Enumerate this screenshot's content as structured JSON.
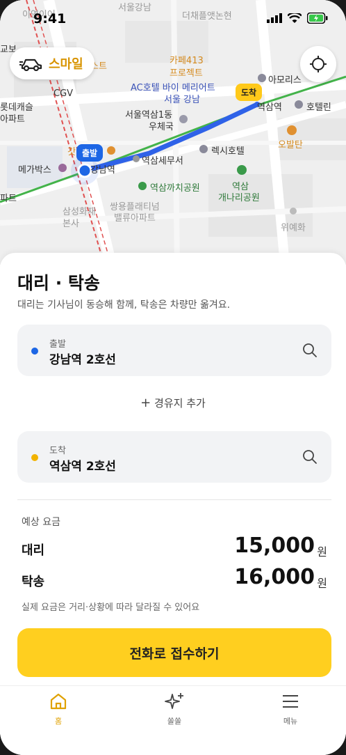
{
  "status_bar": {
    "time": "9:41"
  },
  "brand": {
    "name": "스마일",
    "icon": "car-icon"
  },
  "map": {
    "start_badge": "출발",
    "end_badge": "도착",
    "labels": {
      "l1": "이연이어",
      "l2": "서울강남",
      "l3": "더채플앳논현",
      "l4": "교보",
      "l5": "CGV",
      "l6": "롯데캐슬",
      "l7": "아파트",
      "l8": "카페413",
      "l9": "프로젝트",
      "l10": "AC호텔 바이 메리어트",
      "l11": "서울 강남",
      "l12": "아모리스",
      "l13": "역삼역",
      "l14": "호텔린",
      "l15": "서울역삼1동",
      "l16": "우체국",
      "l17": "오발탄",
      "l18": "렉시호텔",
      "l19": "메가박스",
      "l20": "강남역",
      "l21": "역삼세무서",
      "l22": "역삼까치공원",
      "l23": "역삼",
      "l24": "개나리공원",
      "l25": "삼성화재",
      "l26": "본사",
      "l27": "쌍용플래티넘",
      "l28": "밸류아파트",
      "l29": "위예화",
      "l30": "파트",
      "l31": "갓",
      "l32": "스트"
    }
  },
  "sheet": {
    "title": "대리 · 탁송",
    "subtitle": "대리는 기사님이 동승해 함께, 탁송은 차량만 옮겨요.",
    "origin": {
      "label": "출발",
      "value": "강남역 2호선",
      "color": "#1d66e5"
    },
    "waypoint": "경유지 추가",
    "destination": {
      "label": "도착",
      "value": "역삼역 2호선",
      "color": "#f2b300"
    },
    "fare_label": "예상 요금",
    "fares": [
      {
        "name": "대리",
        "amount": "15,000",
        "unit": "원"
      },
      {
        "name": "탁송",
        "amount": "16,000",
        "unit": "원"
      }
    ],
    "note": "실제 요금은 거리·상황에 따라 달라질 수 있어요",
    "cta": "전화로 접수하기"
  },
  "tabs": [
    {
      "label": "홈",
      "icon": "home-icon",
      "active": true
    },
    {
      "label": "쏠쏠",
      "icon": "sparkle-icon",
      "active": false
    },
    {
      "label": "메뉴",
      "icon": "menu-icon",
      "active": false
    }
  ],
  "colors": {
    "accent": "#ffcf1f",
    "route": "#2f62e8",
    "brand": "#d89400"
  }
}
